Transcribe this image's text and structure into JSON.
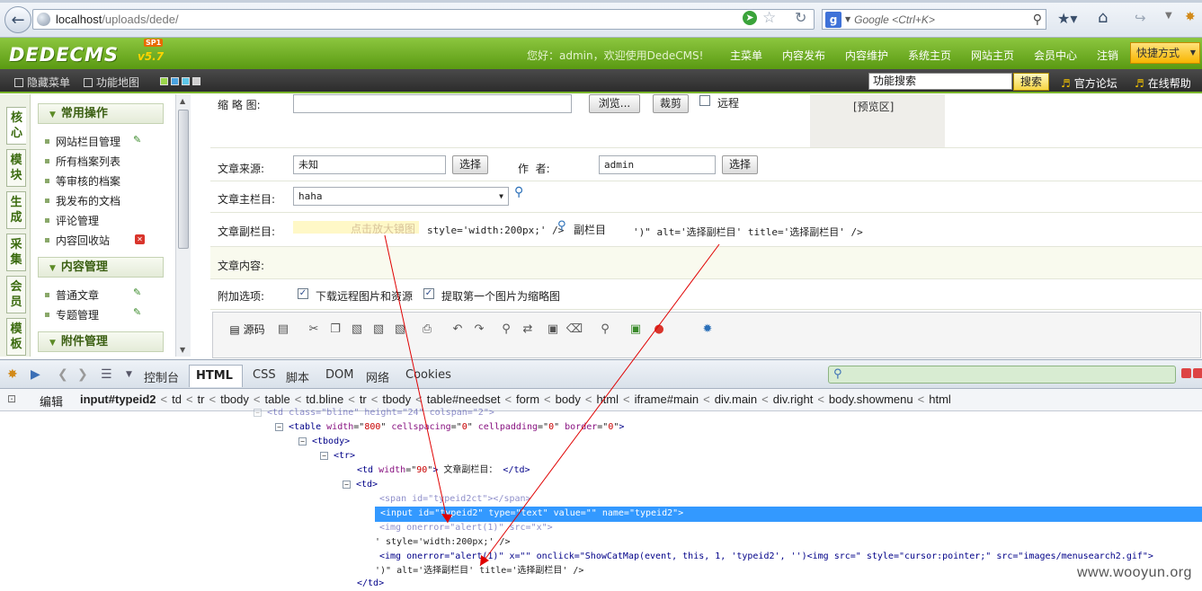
{
  "browser": {
    "url_host": "localhost",
    "url_path": "/uploads/dede/",
    "search_placeholder": "Google <Ctrl+K>",
    "search_engine_letter": "g"
  },
  "cms_header": {
    "logo": "DEDECMS",
    "version": "v5.7",
    "edition": "SP1",
    "welcome": "您好：admin，欢迎使用DedeCMS!",
    "nav": [
      "主菜单",
      "内容发布",
      "内容维护",
      "系统主页",
      "网站主页",
      "会员中心",
      "注销"
    ],
    "quick": "快捷方式"
  },
  "subbar": {
    "hide_menu": "隐藏菜单",
    "site_map": "功能地图",
    "search_value": "功能搜索",
    "search_btn": "搜索",
    "forum": "官方论坛",
    "help": "在线帮助"
  },
  "vtabs": [
    "核心",
    "模块",
    "生成",
    "采集",
    "会员",
    "模板"
  ],
  "sidemenu": {
    "group1": "常用操作",
    "group1_items": [
      "网站栏目管理",
      "所有档案列表",
      "等审核的档案",
      "我发布的文档",
      "评论管理",
      "内容回收站"
    ],
    "group2": "内容管理",
    "group2_items": [
      "普通文章",
      "专题管理"
    ],
    "group3": "附件管理"
  },
  "form": {
    "thumb_label": "缩 略 图:",
    "browse_btn": "浏览...",
    "crop_btn": "裁剪",
    "remote_label": "远程",
    "preview_label": "[预览区]",
    "source_label": "文章来源:",
    "source_value": "未知",
    "select_btn": "选择",
    "author_label": "作  者:",
    "author_value": "admin",
    "main_cat_label": "文章主栏目:",
    "main_cat_value": "haha",
    "sub_cat_label": "文章副栏目:",
    "sub_cat_hint": "点击放大镜图",
    "sub_cat_leak1": "style='width:200px;' />",
    "sub_cat_btn": "副栏目",
    "sub_cat_leak2": "')\" alt='选择副栏目' title='选择副栏目' />",
    "content_label": "文章内容:",
    "extra_label": "附加选项:",
    "opt1": "下载远程图片和资源",
    "opt2": "提取第一个图片为缩略图",
    "editor_source": "源码"
  },
  "firebug": {
    "tabs": [
      "控制台",
      "HTML",
      "CSS",
      "脚本",
      "DOM",
      "网络",
      "Cookies"
    ],
    "edit": "编辑",
    "crumbs": [
      "input#typeid2",
      "td",
      "tr",
      "tbody",
      "table",
      "td.bline",
      "tr",
      "tbody",
      "table#needset",
      "form",
      "body",
      "html",
      "iframe#main",
      "div.main",
      "div.right",
      "body.showmenu",
      "html"
    ],
    "html_lines": {
      "l0": "<td class=\"bline\" height=\"24\" colspan=\"2\">",
      "l1_tag": "<table",
      "l1_attrs": [
        [
          "width",
          "800"
        ],
        [
          "cellspacing",
          "0"
        ],
        [
          "cellpadding",
          "0"
        ],
        [
          "border",
          "0"
        ]
      ],
      "l2": "<tbody>",
      "l3": "<tr>",
      "l4_tag": "<td",
      "l4_attr": "width",
      "l4_val": "90",
      "l4_text": "文章副栏目：",
      "l4_close": "</td>",
      "l5": "<td>",
      "l6": "<span id=\"typeid2ct\"></span>",
      "l7": "<input id=\"typeid2\" type=\"text\" value=\"\" name=\"typeid2\">",
      "l8": "<img onerror=\"alert(1)\" src=\"x\">",
      "l9": "' style='width:200px;' />",
      "l10": "<img onerror=\"alert(1)\" x=\"\" onclick=\"ShowCatMap(event, this, 1, 'typeid2', '')<img src=\" style=\"cursor:pointer;\" src=\"images/menusearch2.gif\">",
      "l11": "')\" alt='选择副栏目' title='选择副栏目' />",
      "l12": "</td>"
    }
  },
  "watermark": "www.wooyun.org",
  "colors": {
    "header_green": "#7ab52a",
    "selection_blue": "#3399ff",
    "arrow_red": "#e00000"
  }
}
